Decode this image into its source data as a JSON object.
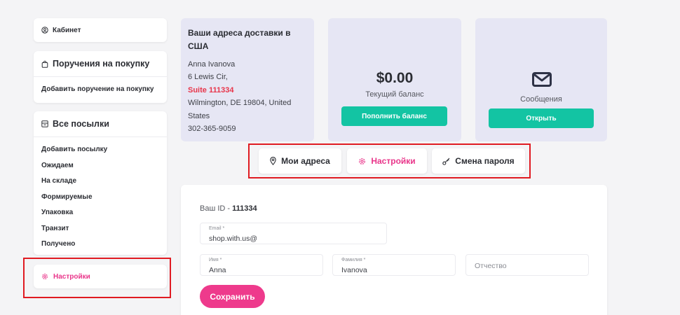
{
  "sidebar": {
    "cabinet": {
      "label": "Кабинет",
      "icon": "user-circle-icon"
    },
    "orders": {
      "title": "Поручения на покупку",
      "icon": "bag-icon",
      "items": [
        {
          "label": "Добавить поручение на покупку"
        }
      ]
    },
    "parcels": {
      "title": "Все посылки",
      "icon": "box-icon",
      "items": [
        {
          "label": "Добавить посылку"
        },
        {
          "label": "Ожидаем"
        },
        {
          "label": "На складе"
        },
        {
          "label": "Формируемые"
        },
        {
          "label": "Упаковка"
        },
        {
          "label": "Транзит"
        },
        {
          "label": "Получено"
        }
      ]
    },
    "settings": {
      "label": "Настройки",
      "icon": "gear-icon"
    }
  },
  "address_card": {
    "title": "Ваши адреса доставки в США",
    "lines": [
      "Anna Ivanova",
      "6 Lewis Cir,",
      "Suite 111334",
      "Wilmington, DE 19804, United States",
      "302-365-9059"
    ]
  },
  "balance_card": {
    "amount": "$0.00",
    "label": "Текущий баланс",
    "button": "Пополнить баланс"
  },
  "messages_card": {
    "label": "Сообщения",
    "button": "Открыть",
    "icon": "envelope-icon"
  },
  "tabs": [
    {
      "label": "Мои адреса",
      "icon": "location-pin-icon"
    },
    {
      "label": "Настройки",
      "icon": "gear-icon",
      "active": true
    },
    {
      "label": "Смена пароля",
      "icon": "key-icon"
    }
  ],
  "form": {
    "id_label": "Ваш ID - ",
    "id_value": "111334",
    "email": {
      "label": "Email *",
      "value": "shop.with.us@"
    },
    "first_name": {
      "label": "Имя *",
      "value": "Anna"
    },
    "last_name": {
      "label": "Фамилия *",
      "value": "Ivanova"
    },
    "middle_name": {
      "placeholder": "Отчество"
    },
    "save_label": "Сохранить"
  },
  "colors": {
    "accent_pink": "#ee3a8c",
    "accent_green": "#13c4a3",
    "highlight_red": "#e01b22",
    "card_lavender": "#e6e6f4"
  }
}
